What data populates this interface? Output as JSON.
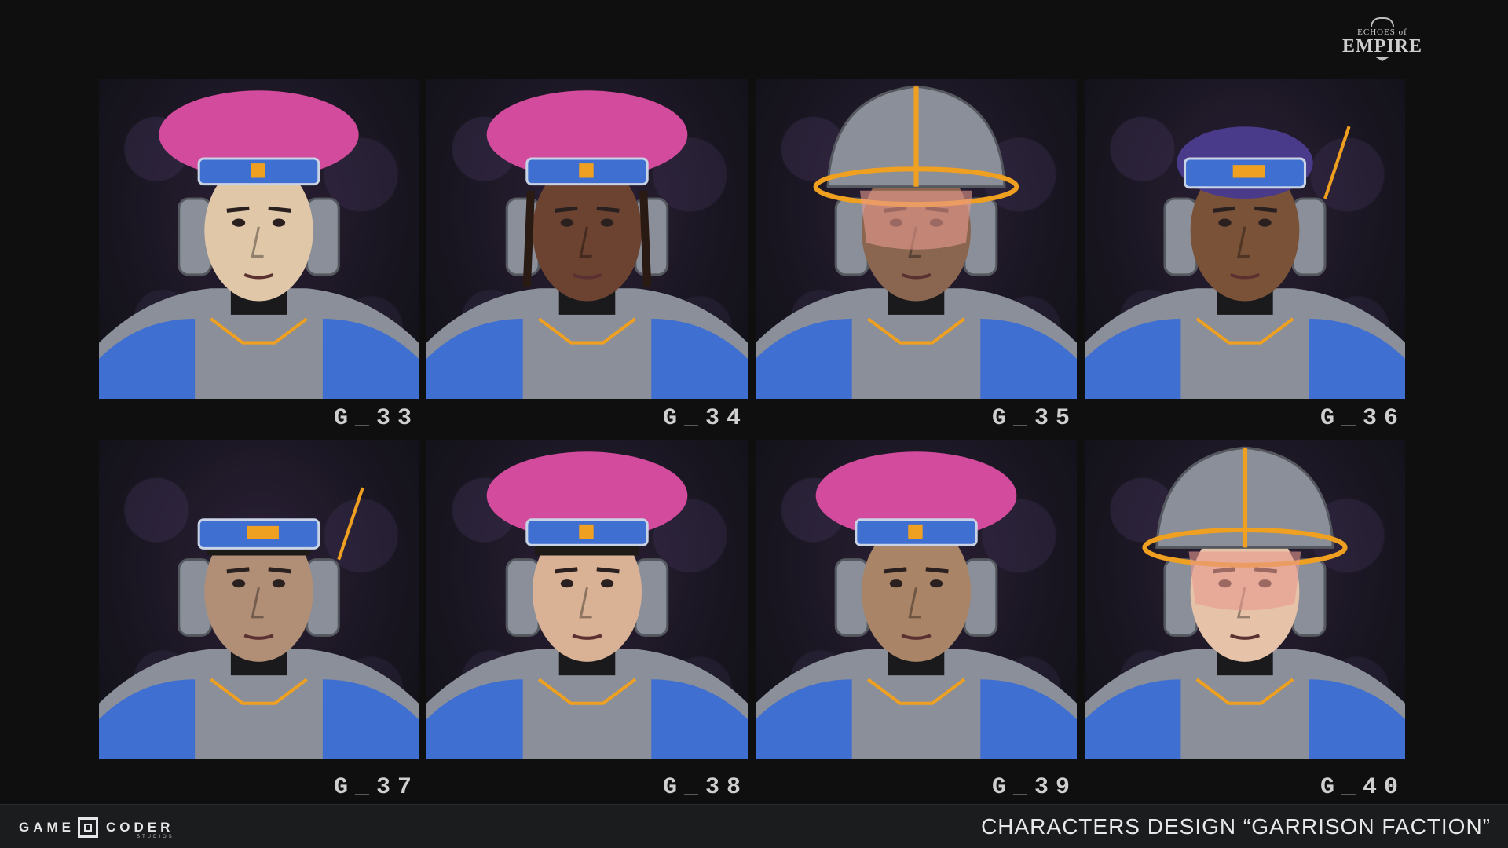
{
  "logo": {
    "line1": "ECHOES of",
    "line2": "EMPIRE"
  },
  "portraits": [
    {
      "id": "G_33",
      "label": "G_33",
      "headgear": "beret",
      "skin": "#e0c7a8",
      "hair": "none"
    },
    {
      "id": "G_34",
      "label": "G_34",
      "headgear": "beret",
      "skin": "#6b4330",
      "hair": "braids"
    },
    {
      "id": "G_35",
      "label": "G_35",
      "headgear": "helmet-visor",
      "skin": "#8a6650",
      "hair": "none"
    },
    {
      "id": "G_36",
      "label": "G_36",
      "headgear": "headband",
      "skin": "#7a5238",
      "hair": "curly-purple"
    },
    {
      "id": "G_37",
      "label": "G_37",
      "headgear": "headband",
      "skin": "#b18e76",
      "hair": "dark"
    },
    {
      "id": "G_38",
      "label": "G_38",
      "headgear": "beret",
      "skin": "#d9b296",
      "hair": "dark"
    },
    {
      "id": "G_39",
      "label": "G_39",
      "headgear": "beret",
      "skin": "#a98467",
      "hair": "none"
    },
    {
      "id": "G_40",
      "label": "G_40",
      "headgear": "helmet-visor",
      "skin": "#e6c2a8",
      "hair": "none"
    }
  ],
  "footer": {
    "studio_name": "GAME CODER",
    "studio_sub": "STUDIOS",
    "title": "CHARACTERS DESIGN “GARRISON FACTION”"
  },
  "colors": {
    "beret": "#d24b9c",
    "armor_blue": "#3f6fd0",
    "armor_grey": "#8a8f99",
    "accent_orange": "#f0a020",
    "visor": "#e89a90"
  }
}
